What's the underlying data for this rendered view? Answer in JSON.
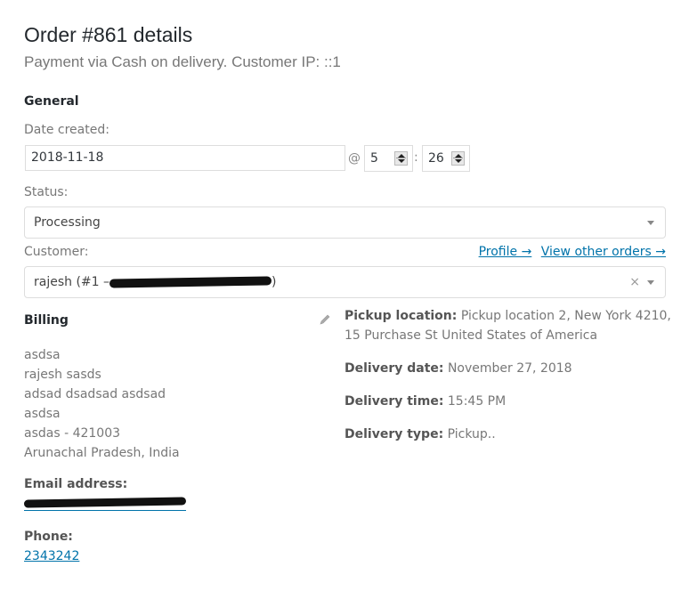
{
  "header": {
    "title": "Order #861 details",
    "subtitle": "Payment via Cash on delivery. Customer IP: ::1"
  },
  "general": {
    "heading": "General",
    "date_label": "Date created:",
    "date_value": "2018-11-18",
    "at_sign": "@",
    "hour_value": "5",
    "colon": ":",
    "minute_value": "26",
    "status_label": "Status:",
    "status_value": "Processing",
    "customer_label": "Customer:",
    "customer_value_prefix": "rajesh (#1 –",
    "customer_value_suffix": ")",
    "profile_link": "Profile →",
    "view_orders_link": "View other orders →",
    "clear_symbol": "×"
  },
  "billing": {
    "heading": "Billing",
    "address_lines": [
      "asdsa",
      "rajesh sasds",
      "adsad dsadsad asdsad",
      "asdsa",
      "asdas - 421003",
      "Arunachal Pradesh, India"
    ],
    "email_label": "Email address:",
    "phone_label": "Phone:",
    "phone_value": "2343242"
  },
  "delivery": {
    "pickup_label": "Pickup location:",
    "pickup_value_line1": "Pickup location 2, New York 4210,",
    "pickup_value_line2": "15 Purchase St United States of America",
    "date_label": "Delivery date:",
    "date_value": "November 27, 2018",
    "time_label": "Delivery time:",
    "time_value": "15:45 PM",
    "type_label": "Delivery type:",
    "type_value": "Pickup.."
  },
  "colors": {
    "link": "#0073aa",
    "heading": "#23282d",
    "muted": "#777777"
  }
}
